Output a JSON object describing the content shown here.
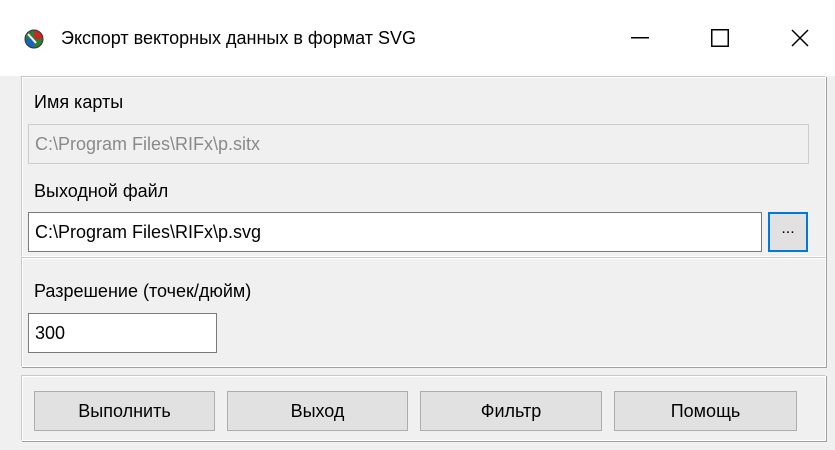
{
  "window": {
    "title": "Экспорт векторных данных в формат SVG",
    "app_icon": "globe-icon",
    "controls": [
      "minimize-icon",
      "maximize-icon",
      "close-icon"
    ]
  },
  "map_name": {
    "label": "Имя карты",
    "value": "C:\\Program Files\\RIFx\\p.sitx"
  },
  "output_file": {
    "label": "Выходной файл",
    "value": "C:\\Program Files\\RIFx\\p.svg",
    "browse_label": "..."
  },
  "resolution": {
    "label": "Разрешение (точек/дюйм)",
    "value": "300"
  },
  "buttons": {
    "execute": "Выполнить",
    "exit": "Выход",
    "filter": "Фильтр",
    "help": "Помощь"
  },
  "colors": {
    "focus_border": "#0078d7",
    "button_bg": "#e1e1e1",
    "window_bg": "#f0f0f0"
  }
}
